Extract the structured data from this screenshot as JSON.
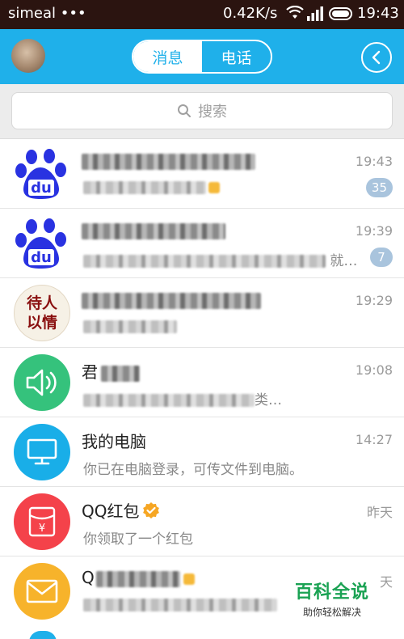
{
  "status_bar": {
    "carrier": "simeal",
    "dots": "•••",
    "network_speed": "0.42K/s",
    "time": "19:43"
  },
  "header": {
    "tabs": [
      {
        "label": "消息",
        "active": true
      },
      {
        "label": "电话",
        "active": false
      }
    ],
    "accent_color": "#1fb0ea"
  },
  "search": {
    "placeholder": "搜索"
  },
  "chats": [
    {
      "avatar": "baidu-paw-icon",
      "time": "19:43",
      "badge": "35"
    },
    {
      "avatar": "baidu-paw-icon",
      "time": "19:39",
      "badge": "7",
      "message_tail": "就…"
    },
    {
      "avatar": "calligraphy-avatar",
      "time": "19:29"
    },
    {
      "avatar": "speaker-icon",
      "name": "君",
      "time": "19:08",
      "message_tail": "类…"
    },
    {
      "avatar": "computer-icon",
      "name": "我的电脑",
      "message": "你已在电脑登录，可传文件到电脑。",
      "time": "14:27"
    },
    {
      "avatar": "red-packet-icon",
      "name": "QQ红包",
      "message": "你领取了一个红包",
      "time": "昨天"
    },
    {
      "avatar": "mail-icon",
      "name": "Q",
      "time": "天"
    }
  ],
  "calligraphy_text": {
    "line1": "待人",
    "line2": "以情"
  },
  "watermark": {
    "title": "百科全说",
    "subtitle": "助你轻松解决"
  }
}
